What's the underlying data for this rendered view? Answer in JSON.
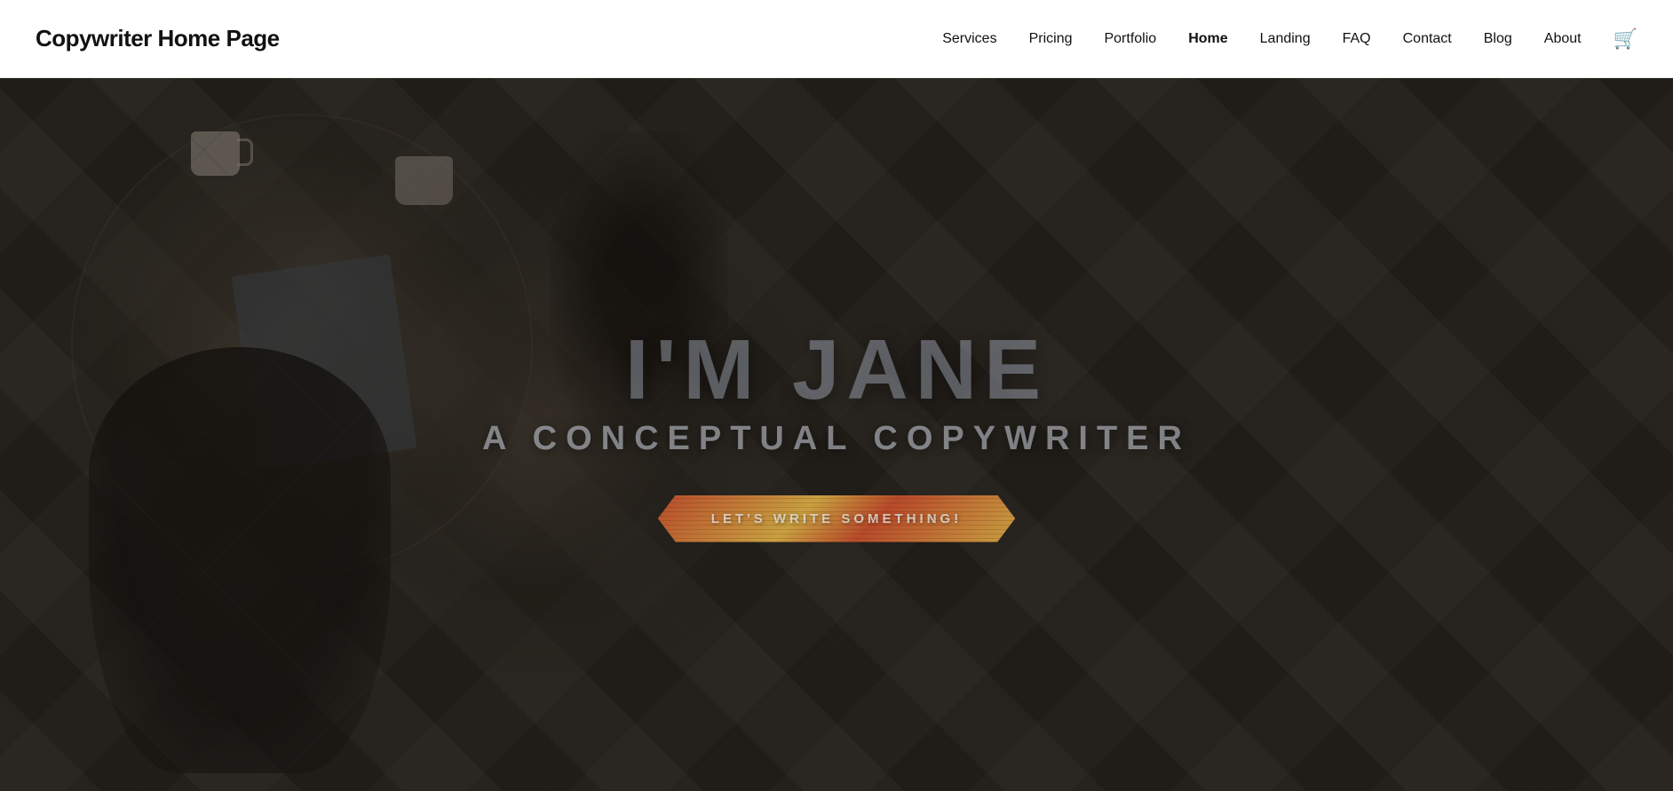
{
  "site": {
    "title": "Copywriter Home Page"
  },
  "nav": {
    "items": [
      {
        "label": "Services",
        "active": false
      },
      {
        "label": "Pricing",
        "active": false
      },
      {
        "label": "Portfolio",
        "active": false
      },
      {
        "label": "Home",
        "active": true
      },
      {
        "label": "Landing",
        "active": false
      },
      {
        "label": "FAQ",
        "active": false
      },
      {
        "label": "Contact",
        "active": false
      },
      {
        "label": "Blog",
        "active": false
      },
      {
        "label": "About",
        "active": false
      }
    ],
    "cart_icon": "🛒"
  },
  "hero": {
    "headline": "I'M JANE",
    "subheadline": "A CONCEPTUAL COPYWRITER",
    "cta_label": "LET'S WRITE SOMETHING!"
  }
}
